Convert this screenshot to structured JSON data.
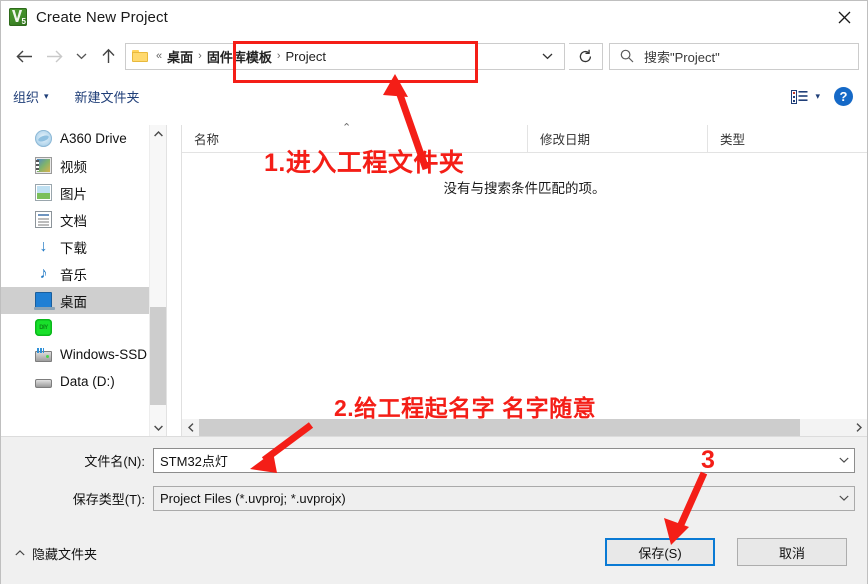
{
  "window": {
    "title": "Create New Project",
    "app_icon": "keil-uvision5-icon",
    "close_label": "close-icon"
  },
  "nav": {
    "back": "back-arrow-icon",
    "forward": "forward-arrow-icon",
    "recent": "recent-locations-chevron-icon",
    "up": "up-arrow-icon",
    "address": {
      "folder_icon": "folder-icon",
      "overflow": "«",
      "crumbs": [
        "桌面",
        "固件库模板",
        "Project"
      ],
      "separator": "›",
      "dropdown": "address-dropdown-chevron-icon",
      "refresh": "refresh-icon"
    },
    "search": {
      "icon": "search-icon",
      "placeholder": "搜索\"Project\""
    }
  },
  "toolbar": {
    "organize": "组织",
    "organize_caret": "▾",
    "new_folder": "新建文件夹",
    "view_icon": "view-layout-icon",
    "view_caret": "▾",
    "help": "?"
  },
  "sidebar": {
    "items": [
      {
        "label": "A360 Drive",
        "icon": "a360-drive-icon",
        "selected": false
      },
      {
        "label": "视频",
        "icon": "videos-icon",
        "selected": false
      },
      {
        "label": "图片",
        "icon": "pictures-icon",
        "selected": false
      },
      {
        "label": "文档",
        "icon": "documents-icon",
        "selected": false
      },
      {
        "label": "下载",
        "icon": "downloads-icon",
        "selected": false
      },
      {
        "label": "音乐",
        "icon": "music-icon",
        "selected": false
      },
      {
        "label": "桌面",
        "icon": "desktop-icon",
        "selected": true
      },
      {
        "label": "",
        "icon": "diy-green-drive-icon",
        "selected": false
      },
      {
        "label": "Windows-SSD",
        "icon": "ssd-drive-icon",
        "selected": false
      },
      {
        "label": "Data (D:)",
        "icon": "hard-drive-icon",
        "selected": false
      }
    ],
    "scroll_up": "⌃",
    "scroll_down": "⌄"
  },
  "filelist": {
    "columns": [
      "名称",
      "修改日期",
      "类型"
    ],
    "sort_indicator": "⌃",
    "empty_message": "没有与搜索条件匹配的项。",
    "rows": [],
    "hscroll_left": "‹",
    "hscroll_right": "›"
  },
  "form": {
    "filename_label": "文件名(N):",
    "filename_value": "STM32点灯",
    "savetype_label": "保存类型(T):",
    "savetype_value": "Project Files (*.uvproj; *.uvprojx)",
    "chevron": "⌄"
  },
  "footer": {
    "hide_folders": "隐藏文件夹",
    "hide_folders_caret": "⌃",
    "save_button": "保存(S)",
    "cancel_button": "取消"
  },
  "annotations": {
    "accent_color": "#f41e17",
    "step1": "1.进入工程文件夹",
    "step2": "2.给工程起名字 名字随意",
    "step3": "3"
  }
}
